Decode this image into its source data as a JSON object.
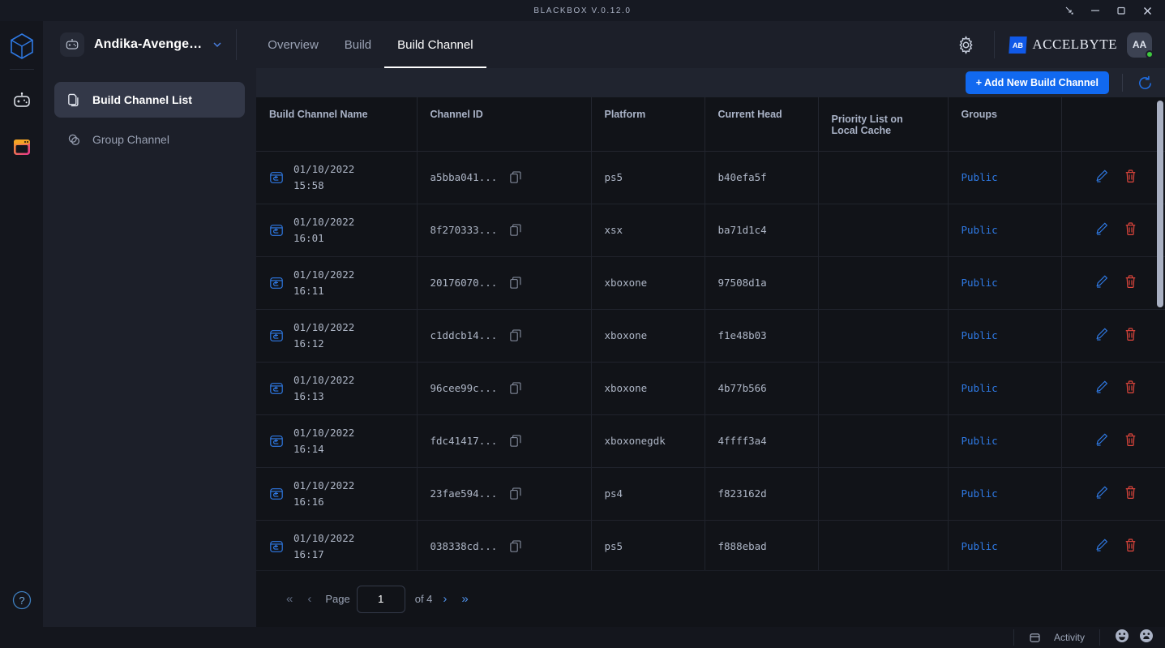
{
  "window": {
    "title": "BLACKBOX V.0.12.0",
    "controls": [
      {
        "name": "restore-down",
        "label": "↘"
      },
      {
        "name": "minimize",
        "label": "—"
      },
      {
        "name": "maximize",
        "label": "□"
      },
      {
        "name": "close",
        "label": "✕"
      }
    ]
  },
  "rail": {
    "logo_name": "cube-logo",
    "items": [
      {
        "name": "robot-icon"
      },
      {
        "name": "window-app-icon"
      }
    ],
    "help_label": "?"
  },
  "header": {
    "project_name": "Andika-Avenge…",
    "project_icon": "robot-icon",
    "caret": "chevron-down-icon",
    "tabs": [
      {
        "label": "Overview",
        "active": false
      },
      {
        "label": "Build",
        "active": false
      },
      {
        "label": "Build Channel",
        "active": true
      }
    ],
    "settings_icon": "gear-icon",
    "brand_mark": "AB",
    "brand_text": "ACCELBYTE",
    "avatar_initials": "AA",
    "accent": "#1169f0"
  },
  "sidebar": {
    "items": [
      {
        "label": "Build Channel List",
        "icon": "documents-icon",
        "active": true
      },
      {
        "label": "Group Channel",
        "icon": "group-circles-icon",
        "active": false
      }
    ]
  },
  "toolbar": {
    "add_label": "+ Add New Build Channel",
    "refresh_icon": "refresh-icon"
  },
  "table": {
    "columns": [
      "Build Channel Name",
      "Channel ID",
      "Platform",
      "Current Head",
      "Priority List on\nLocal Cache",
      "Groups",
      ""
    ],
    "column_priority_line1": "Priority List on",
    "column_priority_line2": "Local Cache",
    "rows": [
      {
        "date": "01/10/2022",
        "time": "15:58",
        "channel_id": "a5bba041...",
        "platform": "ps5",
        "current_head": "b40efa5f",
        "priority": "",
        "group": "Public"
      },
      {
        "date": "01/10/2022",
        "time": "16:01",
        "channel_id": "8f270333...",
        "platform": "xsx",
        "current_head": "ba71d1c4",
        "priority": "",
        "group": "Public"
      },
      {
        "date": "01/10/2022",
        "time": "16:11",
        "channel_id": "20176070...",
        "platform": "xboxone",
        "current_head": "97508d1a",
        "priority": "",
        "group": "Public"
      },
      {
        "date": "01/10/2022",
        "time": "16:12",
        "channel_id": "c1ddcb14...",
        "platform": "xboxone",
        "current_head": "f1e48b03",
        "priority": "",
        "group": "Public"
      },
      {
        "date": "01/10/2022",
        "time": "16:13",
        "channel_id": "96cee99c...",
        "platform": "xboxone",
        "current_head": "4b77b566",
        "priority": "",
        "group": "Public"
      },
      {
        "date": "01/10/2022",
        "time": "16:14",
        "channel_id": "fdc41417...",
        "platform": "xboxonegdk",
        "current_head": "4ffff3a4",
        "priority": "",
        "group": "Public"
      },
      {
        "date": "01/10/2022",
        "time": "16:16",
        "channel_id": "23fae594...",
        "platform": "ps4",
        "current_head": "f823162d",
        "priority": "",
        "group": "Public"
      },
      {
        "date": "01/10/2022",
        "time": "16:17",
        "channel_id": "038338cd...",
        "platform": "ps5",
        "current_head": "f888ebad",
        "priority": "",
        "group": "Public"
      }
    ],
    "row_icon": "restore-channel-icon",
    "copy_icon": "copy-icon",
    "edit_icon": "pencil-edit-icon",
    "delete_icon": "trash-delete-icon"
  },
  "pagination": {
    "first_label": "«",
    "prev_label": "‹",
    "page_label": "Page",
    "page_value": "1",
    "of_label": "of 4",
    "next_label": "›",
    "last_label": "»"
  },
  "statusbar": {
    "activity_icon": "activity-panel-icon",
    "activity_label": "Activity",
    "happy_icon": "happy-face-icon",
    "sad_icon": "sad-face-icon"
  }
}
